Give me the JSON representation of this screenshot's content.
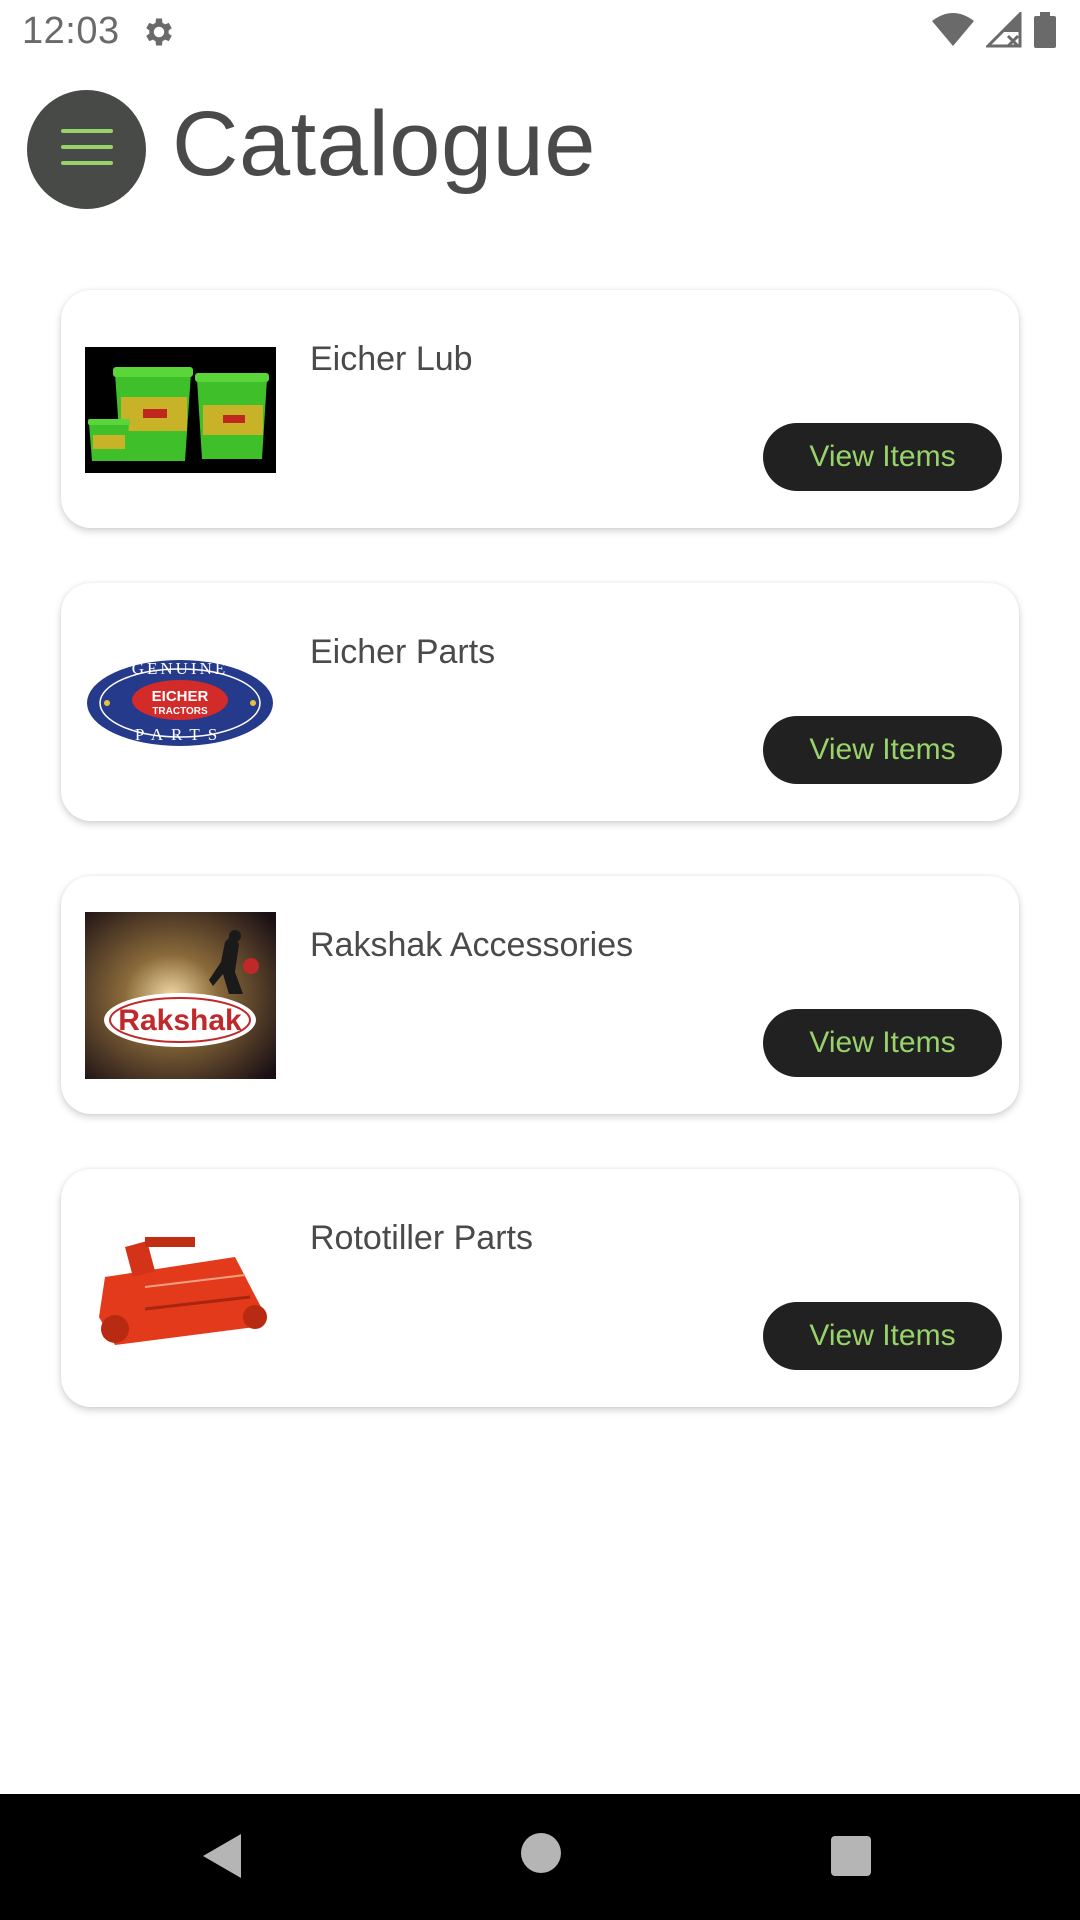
{
  "status_bar": {
    "time": "12:03",
    "icons": [
      "settings-gear-icon",
      "wifi-icon",
      "cellular-no-data-icon",
      "battery-icon"
    ]
  },
  "header": {
    "menu_icon": "hamburger-menu-icon",
    "title": "Catalogue"
  },
  "colors": {
    "button_bg": "#212121",
    "button_text": "#98d36a",
    "menu_bg": "#484a47",
    "menu_icon": "#98d36a"
  },
  "catalogue": [
    {
      "name": "Eicher Lub",
      "button": "View Items",
      "thumb": "lubricant-buckets-image"
    },
    {
      "name": "Eicher Parts",
      "button": "View Items",
      "thumb": "genuine-eicher-parts-logo"
    },
    {
      "name": "Rakshak Accessories",
      "button": "View Items",
      "thumb": "rakshak-logo"
    },
    {
      "name": "Rototiller Parts",
      "button": "View Items",
      "thumb": "rototiller-image"
    }
  ],
  "logo_text": {
    "genuine": "GENUINE",
    "eicher": "EICHER",
    "tractors": "TRACTORS",
    "parts": "PARTS",
    "rakshak": "Rakshak"
  },
  "nav_bar": {
    "icons": [
      "back-icon",
      "home-icon",
      "recents-icon"
    ]
  }
}
